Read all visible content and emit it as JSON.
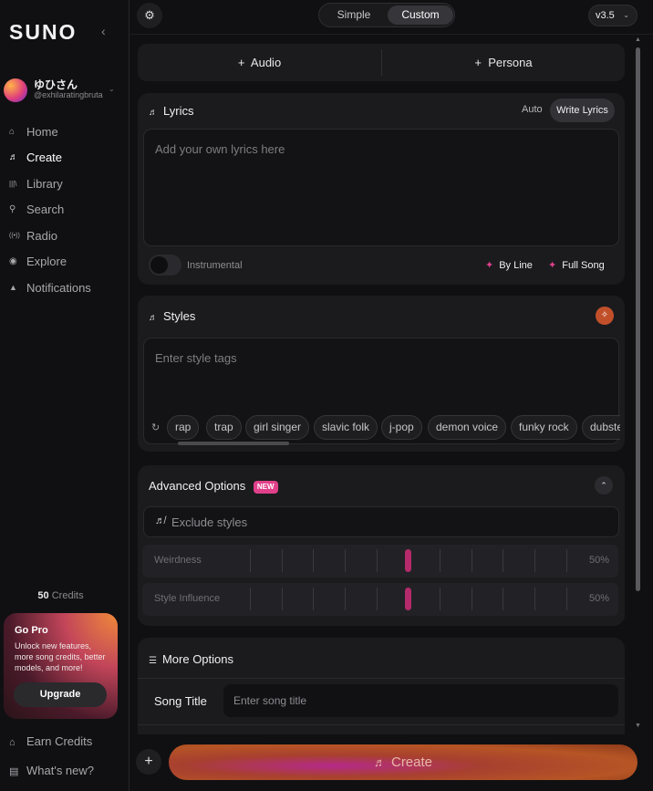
{
  "sidebar": {
    "logo": "SUNO",
    "user": {
      "name": "ゆひさん",
      "handle": "@exhilaratingbruta"
    },
    "nav": [
      {
        "label": "Home",
        "icon": "home-icon",
        "glyph": "⌂",
        "active": false
      },
      {
        "label": "Create",
        "icon": "music-note-icon",
        "glyph": "♬",
        "active": true
      },
      {
        "label": "Library",
        "icon": "library-icon",
        "glyph": "|||\\",
        "active": false
      },
      {
        "label": "Search",
        "icon": "search-icon",
        "glyph": "⚲",
        "active": false
      },
      {
        "label": "Radio",
        "icon": "radio-icon",
        "glyph": "((•))",
        "active": false
      },
      {
        "label": "Explore",
        "icon": "compass-icon",
        "glyph": "◉",
        "active": false
      },
      {
        "label": "Notifications",
        "icon": "bell-icon",
        "glyph": "🔔",
        "active": false
      }
    ],
    "credits_count": "50",
    "credits_label": "Credits",
    "go_pro": {
      "title": "Go Pro",
      "description": "Unlock new features, more song credits, better models, and more!",
      "button": "Upgrade"
    },
    "earn_credits": "Earn Credits",
    "whats_new": "What's new?"
  },
  "topbar": {
    "modes": [
      "Simple",
      "Custom"
    ],
    "selected_mode": "Custom",
    "version": "v3.5"
  },
  "add_buttons": {
    "audio": "Audio",
    "persona": "Persona"
  },
  "lyrics": {
    "title": "Lyrics",
    "auto": "Auto",
    "write": "Write Lyrics",
    "placeholder": "Add your own lyrics here",
    "instrumental": "Instrumental",
    "by_line": "By Line",
    "full_song": "Full Song"
  },
  "styles": {
    "title": "Styles",
    "placeholder": "Enter style tags",
    "tags": [
      "rap",
      "trap",
      "girl singer",
      "slavic folk",
      "j-pop",
      "demon voice",
      "funky rock",
      "dubstep"
    ]
  },
  "advanced": {
    "title": "Advanced Options",
    "badge": "NEW",
    "exclude_placeholder": "Exclude styles",
    "weirdness": {
      "label": "Weirdness",
      "value": "50%"
    },
    "style_influence": {
      "label": "Style Influence",
      "value": "50%"
    }
  },
  "more": {
    "title": "More Options",
    "song_title_label": "Song Title",
    "song_title_placeholder": "Enter song title"
  },
  "create_button": "Create",
  "colors": {
    "accent_pink": "#e0408a",
    "create_gradient_start": "#b52a8a",
    "create_gradient_end": "#b65525"
  }
}
